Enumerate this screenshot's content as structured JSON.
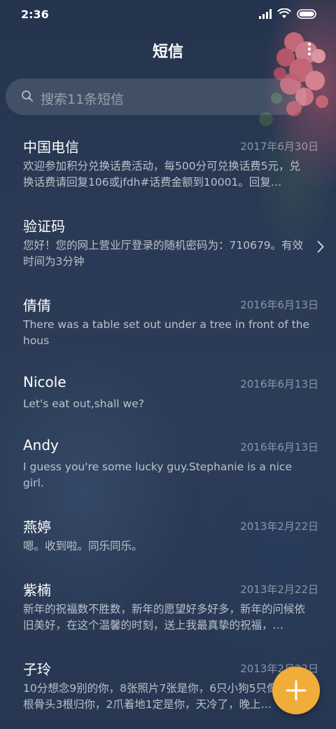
{
  "status_bar": {
    "time": "2:36",
    "icons": [
      "signal-icon",
      "wifi-icon",
      "battery-icon"
    ]
  },
  "header": {
    "title": "短信",
    "more_icon": "more-vertical-icon"
  },
  "search": {
    "placeholder": "搜索11条短信",
    "icon": "search-icon"
  },
  "messages": [
    {
      "name": "中国电信",
      "date": "2017年6月30日",
      "preview": "欢迎参加积分兑换话费活动，每500分可兑换话费5元，兑换话费请回复106或jfdh#话费金额到10001。回复…"
    },
    {
      "name": "验证码",
      "date": "",
      "preview": "您好！您的网上营业厅登录的随机密码为：710679。有效时间为3分钟",
      "has_chevron": true
    },
    {
      "name": "倩倩",
      "date": "2016年6月13日",
      "preview": "There was a table set out under a tree in front of the hous"
    },
    {
      "name": "Nicole",
      "date": "2016年6月13日",
      "preview": "Let's eat out,shall we?"
    },
    {
      "name": "Andy",
      "date": "2016年6月13日",
      "preview": "I guess you're some lucky guy.Stephanie is a nice girl."
    },
    {
      "name": "燕婷",
      "date": "2013年2月22日",
      "preview": "嗯。收到啦。同乐同乐。"
    },
    {
      "name": "紫楠",
      "date": "2013年2月22日",
      "preview": "新年的祝福数不胜数，新年的愿望好多好多，新年的问候依旧美好，在这个温馨的时刻，送上我最真挚的祝福，…"
    },
    {
      "name": "子玲",
      "date": "2013年2月22日",
      "preview": "10分想念9别的你，8张照片7张是你，6只小狗5只像你，4根骨头3根归你，2爪着地1定是你，天冷了，晚上…"
    }
  ],
  "fab": {
    "icon": "plus-icon",
    "color": "#f0ad3a"
  }
}
